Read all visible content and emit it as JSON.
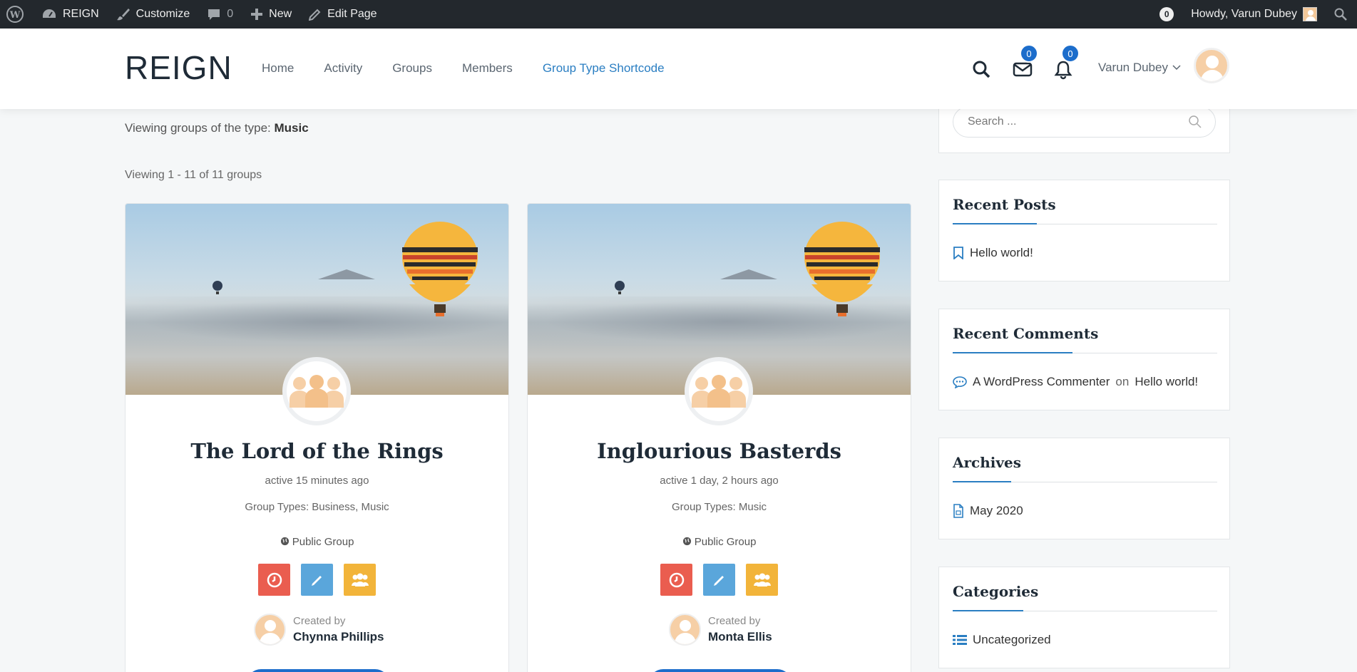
{
  "adminbar": {
    "site_name": "REIGN",
    "customize": "Customize",
    "comments_count": "0",
    "new": "New",
    "edit_page": "Edit Page",
    "notif_count": "0",
    "howdy": "Howdy, Varun Dubey"
  },
  "header": {
    "logo": "REIGN",
    "nav": [
      "Home",
      "Activity",
      "Groups",
      "Members",
      "Group Type Shortcode"
    ],
    "messages_badge": "0",
    "notifications_badge": "0",
    "user_name": "Varun Dubey"
  },
  "main": {
    "viewing_type_prefix": "Viewing groups of the type:",
    "viewing_type_value": "Music",
    "viewing_count": "Viewing 1 - 11 of 11 groups",
    "groups": [
      {
        "title": "The Lord of the Rings",
        "active": "active 15 minutes ago",
        "types": "Group Types: Business, Music",
        "status": "Public Group",
        "created_by_label": "Created by",
        "creator": "Chynna Phillips"
      },
      {
        "title": "Inglourious Basterds",
        "active": "active 1 day, 2 hours ago",
        "types": "Group Types: Music",
        "status": "Public Group",
        "created_by_label": "Created by",
        "creator": "Monta Ellis"
      }
    ]
  },
  "sidebar": {
    "search_placeholder": "Search ...",
    "recent_posts": {
      "title": "Recent Posts",
      "items": [
        "Hello world!"
      ]
    },
    "recent_comments": {
      "title": "Recent Comments",
      "author": "A WordPress Commenter",
      "on": "on",
      "post": "Hello world!"
    },
    "archives": {
      "title": "Archives",
      "items": [
        "May 2020"
      ]
    },
    "categories": {
      "title": "Categories",
      "items": [
        "Uncategorized"
      ]
    }
  },
  "colors": {
    "accent": "#2a7ec2",
    "badge": "#1c6dcb",
    "action_red": "#ea5d4f",
    "action_blue": "#5aa6db",
    "action_yellow": "#f2b43a"
  }
}
